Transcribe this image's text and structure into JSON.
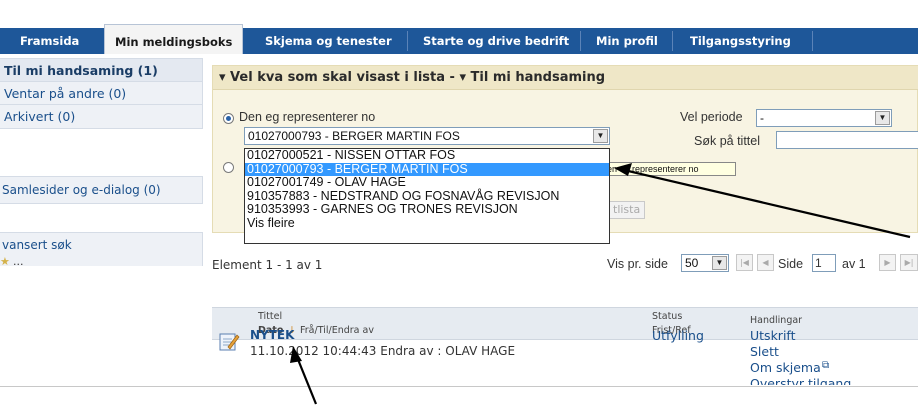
{
  "topnav": {
    "tabs": [
      {
        "label": "Framsida"
      },
      {
        "label": "Min meldingsboks"
      },
      {
        "label": "Skjema og tenester"
      },
      {
        "label": "Starte og drive bedrift"
      },
      {
        "label": "Min profil"
      },
      {
        "label": "Tilgangsstyring"
      }
    ],
    "active_index": 1
  },
  "sidebar": {
    "items": [
      {
        "label": "Til mi handsaming (1)"
      },
      {
        "label": "Ventar på andre (0)"
      },
      {
        "label": "Arkivert (0)"
      }
    ],
    "samlesider": "Samlesider og e-dialog (0)",
    "advanced_search": "vansert søk",
    "favorite": "..."
  },
  "filter": {
    "title": "▾ Vel kva som skal visast i lista - ▾ Til mi handsaming",
    "radio1_label": "Den eg representerer no",
    "selected_value": "01027000793 - BERGER MARTIN FOS",
    "dropdown_options": [
      "01027000521 - NISSEN OTTAR FOS",
      "01027000793 - BERGER MARTIN FOS",
      "01027001749 - OLAV HAGE",
      "910357883 - NEDSTRAND OG FOSNAVÅG REVISJON",
      "910353993 - GARNES OG TRONES REVISJON",
      "Vis fleire"
    ],
    "tooltip": "en eg representerer no",
    "show_button": "tlista",
    "period_label": "Vel periode",
    "period_value": "-",
    "search_title_label": "Søk på tittel"
  },
  "results": {
    "count_text": "Element 1 - 1 av 1",
    "per_page_label": "Vis pr. side",
    "per_page_value": "50",
    "page_label": "Side",
    "page_value": "1",
    "page_of": "av 1",
    "columns": {
      "tittel": "Tittel",
      "dato": "Dato",
      "fra": "Frå/Til/Endra av",
      "status": "Status",
      "frist": "Frist/Ref",
      "handlingar": "Handlingar"
    },
    "rows": [
      {
        "title": "NYTEK",
        "meta": "11.10.2012 10:44:43 Endra av : OLAV HAGE",
        "status": "Utfylling",
        "actions": [
          "Utskrift",
          "Slett",
          "Om skjema",
          "Overstyr tilgang"
        ]
      }
    ]
  },
  "colors": {
    "nav_bg": "#1e5799",
    "panel_bg": "#f8f4e3",
    "link": "#1a4f8b",
    "selected_option": "#3399ff"
  }
}
